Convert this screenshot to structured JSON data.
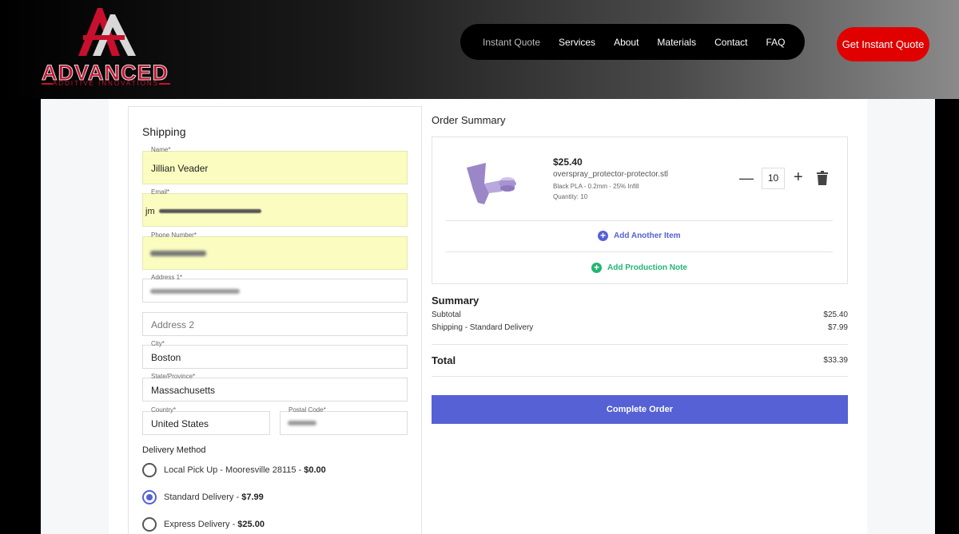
{
  "brand": {
    "name": "ADVANCED",
    "tagline": "ADDITIVE INNOVATIONS",
    "logo_icon": "aai-logo-icon",
    "accent_color": "#c8102e"
  },
  "nav": {
    "items": [
      "Instant Quote",
      "Services",
      "About",
      "Materials",
      "Contact",
      "FAQ"
    ],
    "cta": "Get Instant Quote"
  },
  "shipping": {
    "title": "Shipping",
    "fields": {
      "name": {
        "label": "Name",
        "required": "*",
        "value": "Jillian Veader"
      },
      "email": {
        "label": "Email",
        "required": "*",
        "value": "jm"
      },
      "phone": {
        "label": "Phone Number",
        "required": "*"
      },
      "address1": {
        "label": "Address 1",
        "required": "*"
      },
      "address2": {
        "placeholder": "Address 2"
      },
      "city": {
        "label": "City",
        "required": "*",
        "value": "Boston"
      },
      "state": {
        "label": "State/Province",
        "required": "*",
        "value": "Massachusetts"
      },
      "country": {
        "label": "Country",
        "required": "*",
        "value": "United States"
      },
      "postal": {
        "label": "Postal Code",
        "required": "*"
      }
    },
    "delivery": {
      "title": "Delivery Method",
      "options": [
        {
          "label": "Local Pick Up - Mooresville 28115 - ",
          "price": "$0.00",
          "checked": false
        },
        {
          "label": "Standard Delivery - ",
          "price": "$7.99",
          "checked": true
        },
        {
          "label": "Express Delivery - ",
          "price": "$25.00",
          "checked": false
        }
      ]
    }
  },
  "order": {
    "title": "Order Summary",
    "item": {
      "price": "$25.40",
      "filename": "overspray_protector-protector.stl",
      "specs": "Black PLA - 0.2mm - 25% Infill",
      "quantity_text": "Quantity: 10",
      "quantity": "10",
      "minus": "—",
      "plus": "+",
      "trash_icon": "trash-icon"
    },
    "add_item": "Add Another Item",
    "add_note": "Add Production Note",
    "add_item_color": "#5561d4",
    "add_note_color": "#22b573"
  },
  "summary": {
    "title": "Summary",
    "subtotal_label": "Subtotal",
    "subtotal_value": "$25.40",
    "shipping_label": "Shipping - Standard Delivery",
    "shipping_value": "$7.99",
    "total_label": "Total",
    "total_value": "$33.39",
    "complete_button": "Complete Order"
  }
}
